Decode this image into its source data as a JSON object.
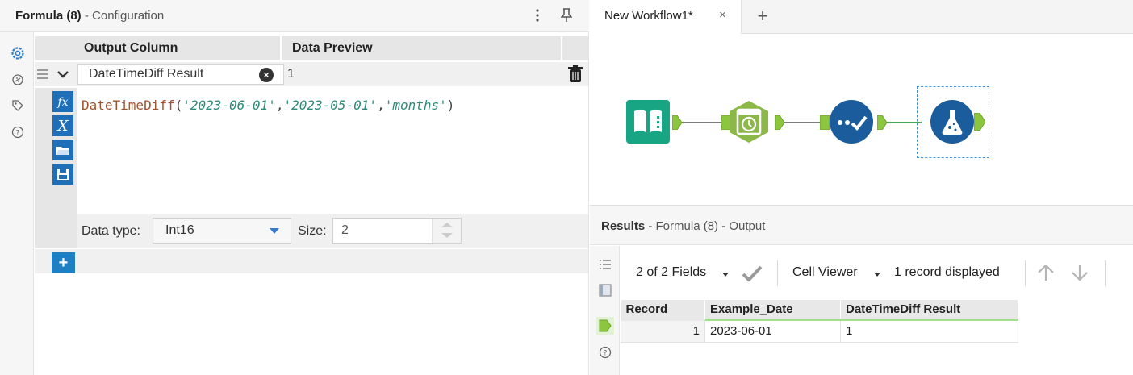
{
  "config_panel": {
    "title": "Formula (8)",
    "subtitle": "- Configuration",
    "menu_icon": "kebab-icon",
    "pin_icon": "pin-icon",
    "side_rail": [
      "gear-icon",
      "link-icon",
      "tag-icon",
      "help-icon"
    ],
    "grid": {
      "col_output": "Output Column",
      "col_preview": "Data Preview",
      "row": {
        "output_column": "DateTimeDiff Result",
        "data_preview": "1"
      },
      "expression": {
        "fn": "DateTimeDiff",
        "arg1": "'2023-06-01'",
        "arg2": "'2023-05-01'",
        "arg3": "'months'"
      },
      "data_type_label": "Data type:",
      "data_type_value": "Int16",
      "size_label": "Size:",
      "size_value": "2",
      "add_label": "+"
    }
  },
  "workflow": {
    "tab_label": "New Workflow1*",
    "tab_close": "×",
    "new_tab": "+",
    "tools": [
      "input-data-tool",
      "datetime-tool",
      "select-tool",
      "formula-tool"
    ],
    "colors": {
      "input": "#18a583",
      "datetime": "#8cb84a",
      "select": "#1b5d9c",
      "formula": "#1b5d9c",
      "anchor": "#8cc63e"
    }
  },
  "results": {
    "title": "Results",
    "subtitle": "- Formula (8) - Output",
    "fields_label": "2 of 2 Fields",
    "viewer_label": "Cell Viewer",
    "records_label": "1 record displayed",
    "columns": [
      "Record",
      "Example_Date",
      "DateTimeDiff Result"
    ],
    "rows": [
      [
        "1",
        "2023-06-01",
        "1"
      ]
    ]
  }
}
